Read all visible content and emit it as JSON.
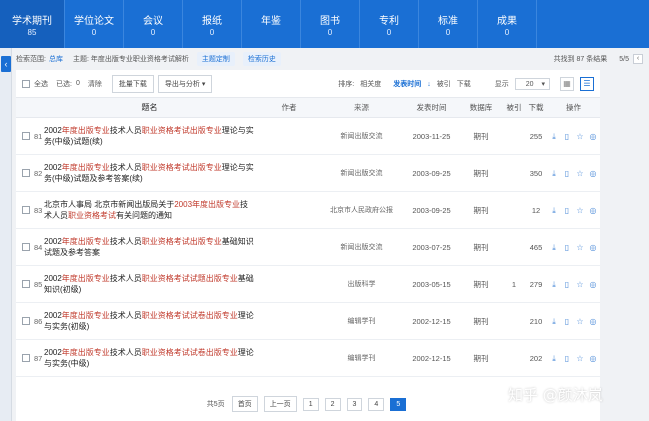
{
  "nav": [
    {
      "label": "学术期刊",
      "count": "85"
    },
    {
      "label": "学位论文",
      "count": "0"
    },
    {
      "label": "会议",
      "count": "0"
    },
    {
      "label": "报纸",
      "count": "0"
    },
    {
      "label": "年鉴",
      "count": ""
    },
    {
      "label": "图书",
      "count": "0"
    },
    {
      "label": "专利",
      "count": "0"
    },
    {
      "label": "标准",
      "count": "0"
    },
    {
      "label": "成果",
      "count": "0"
    }
  ],
  "crumb": {
    "scope_label": "检索范围:",
    "scope": "总库",
    "topic": "主题: 年度出版专业职业资格考试解析",
    "custom_btn": "主题定制",
    "history_btn": "检索历史",
    "total": "共找到 87 条结果",
    "page_ratio": "5/5"
  },
  "toolbar": {
    "select_all": "全选",
    "selected": "已选:",
    "selected_count": "0",
    "clear": "清除",
    "batch_download": "批量下载",
    "export": "导出与分析",
    "sort_label": "排序:",
    "sort_relevance": "相关度",
    "sort_date": "发表时间",
    "sort_cite": "被引",
    "sort_download": "下载",
    "display_label": "显示",
    "display_value": "20"
  },
  "headers": {
    "title": "题名",
    "author": "作者",
    "source": "来源",
    "date": "发表时间",
    "db": "数据库",
    "cite": "被引",
    "download": "下载",
    "ops": "操作"
  },
  "rows": [
    {
      "idx": "81",
      "title_a": "2002",
      "title_b": "年度出版专业",
      "title_c": "技术人员",
      "title_d": "职业资格考试出版专业",
      "title_e": "理论与实务(中级)试题(续)",
      "source": "新闻出版交流",
      "date": "2003-11-25",
      "db": "期刊",
      "cite": "",
      "download": "255"
    },
    {
      "idx": "82",
      "title_a": "2002",
      "title_b": "年度出版专业",
      "title_c": "技术人员",
      "title_d": "职业资格考试出版专业",
      "title_e": "理论与实务(中级)试题及参考答案(续)",
      "source": "新闻出版交流",
      "date": "2003-09-25",
      "db": "期刊",
      "cite": "",
      "download": "350"
    },
    {
      "idx": "83",
      "title_a": "北京市人事局 北京市新闻出版局关于",
      "title_b": "2003年度出版专业",
      "title_c": "技术人员",
      "title_d": "职业资格考试",
      "title_e": "有关问题的通知",
      "source": "北京市人民政府公报",
      "date": "2003-09-25",
      "db": "期刊",
      "cite": "",
      "download": "12"
    },
    {
      "idx": "84",
      "title_a": "2002",
      "title_b": "年度出版专业",
      "title_c": "技术人员",
      "title_d": "职业资格考试出版专业",
      "title_e": "基础知识试题及参考答案",
      "source": "新闻出版交流",
      "date": "2003-07-25",
      "db": "期刊",
      "cite": "",
      "download": "465"
    },
    {
      "idx": "85",
      "title_a": "2002",
      "title_b": "年度出版专业",
      "title_c": "技术人员",
      "title_d": "职业资格考试试题出版专业",
      "title_e": "基础知识(初级)",
      "source": "出版科学",
      "date": "2003-05-15",
      "db": "期刊",
      "cite": "1",
      "download": "279"
    },
    {
      "idx": "86",
      "title_a": "2002",
      "title_b": "年度出版专业",
      "title_c": "技术人员",
      "title_d": "职业资格考试试卷出版专业",
      "title_e": "理论与实务(初级)",
      "source": "编辑学刊",
      "date": "2002-12-15",
      "db": "期刊",
      "cite": "",
      "download": "210"
    },
    {
      "idx": "87",
      "title_a": "2002",
      "title_b": "年度出版专业",
      "title_c": "技术人员",
      "title_d": "职业资格考试试卷出版专业",
      "title_e": "理论与实务(中级)",
      "source": "编辑学刊",
      "date": "2002-12-15",
      "db": "期刊",
      "cite": "",
      "download": "202"
    }
  ],
  "pager": {
    "total_pages": "共5页",
    "first": "首页",
    "prev": "上一页",
    "p1": "1",
    "p2": "2",
    "p3": "3",
    "p4": "4",
    "p5": "5"
  },
  "watermark": "知乎 @颜沐岚"
}
